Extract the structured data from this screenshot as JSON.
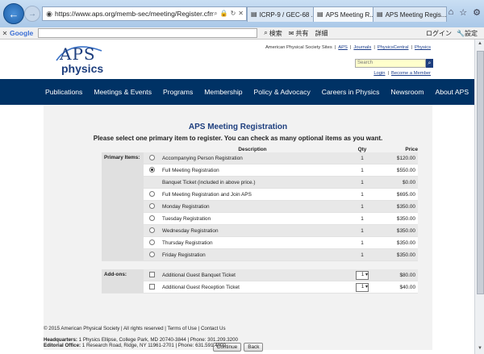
{
  "browser": {
    "url": "https://www.aps.org/memb-sec/meeting/Register.cfm?event_",
    "tabs": [
      {
        "label": "ICRP-9 / GEC-68 ..."
      },
      {
        "label": "APS Meeting R..."
      },
      {
        "label": "APS Meeting Regis..."
      }
    ]
  },
  "google_toolbar": {
    "logo": "Google",
    "search_label": "検索",
    "share_label": "共有",
    "details_label": "詳細",
    "login_label": "ログイン",
    "settings_label": "設定"
  },
  "site": {
    "logo_top": "APS",
    "logo_bottom": "physics",
    "top_links": {
      "sites_label": "American Physical Society Sites",
      "sep": "|",
      "aps": "APS",
      "journals": "Journals",
      "physicscentral": "PhysicsCentral",
      "physics": "Physics"
    },
    "search_placeholder": "Search",
    "login_links": {
      "login": "Login",
      "become_member": "Become a Member"
    },
    "nav": [
      "Publications",
      "Meetings & Events",
      "Programs",
      "Membership",
      "Policy & Advocacy",
      "Careers in Physics",
      "Newsroom",
      "About APS"
    ]
  },
  "registration": {
    "title": "APS Meeting Registration",
    "instructions": "Please select one primary item to register. You can check as many optional items as you want.",
    "headers": {
      "description": "Description",
      "qty": "Qty",
      "price": "Price"
    },
    "primary_label": "Primary Items:",
    "primary_items": [
      {
        "description": "Accompanying Person Registration",
        "qty": "1",
        "price": "$120.00",
        "selected": false
      },
      {
        "description": "Full Meeting Registration",
        "qty": "1",
        "price": "$550.00",
        "selected": true
      },
      {
        "description": "Banquet Ticket (included in above price.)",
        "qty": "1",
        "price": "$0.00",
        "selected": false,
        "no_control": true
      },
      {
        "description": "Full Meeting Registration and Join APS",
        "qty": "1",
        "price": "$695.00",
        "selected": false
      },
      {
        "description": "Monday Registration",
        "qty": "1",
        "price": "$350.00",
        "selected": false
      },
      {
        "description": "Tuesday Registration",
        "qty": "1",
        "price": "$350.00",
        "selected": false
      },
      {
        "description": "Wednesday Registration",
        "qty": "1",
        "price": "$350.00",
        "selected": false
      },
      {
        "description": "Thursday Registration",
        "qty": "1",
        "price": "$350.00",
        "selected": false
      },
      {
        "description": "Friday Registration",
        "qty": "1",
        "price": "$350.00",
        "selected": false
      }
    ],
    "addons_label": "Add-ons:",
    "addons": [
      {
        "description": "Additional Guest Banquet Ticket",
        "qty": "1",
        "price": "$80.00"
      },
      {
        "description": "Additional Guest Reception Ticket",
        "qty": "1",
        "price": "$40.00"
      }
    ],
    "continue_label": "Continue",
    "back_label": "Back"
  },
  "footer": {
    "copyright": "© 2015 American Physical Society | All rights reserved | Terms of Use | Contact Us",
    "hq_label": "Headquarters:",
    "hq": " 1 Physics Ellipse, College Park, MD 20740-3844 | Phone: 301.209.3200",
    "ed_label": "Editorial Office:",
    "ed": " 1 Research Road, Ridge, NY 11961-2701 | Phone: 631.591.4000"
  }
}
